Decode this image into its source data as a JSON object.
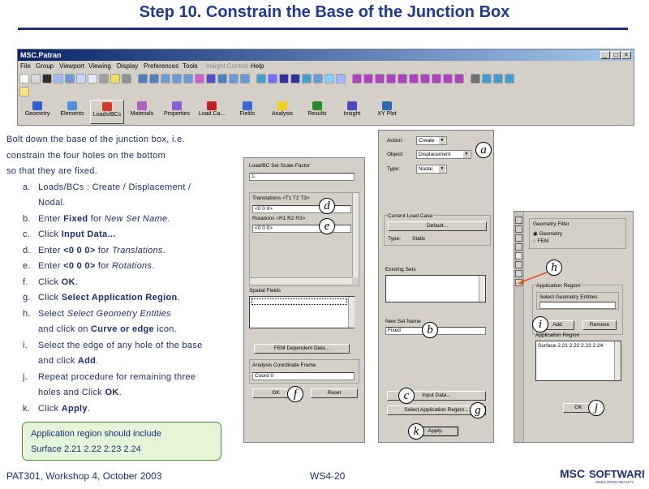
{
  "slide": {
    "title": "Step 10.  Constrain the Base of the Junction Box",
    "footer_left": "PAT301, Workshop 4, October 2003",
    "footer_center": "WS4-20",
    "logo": "MSC SOFTWARE",
    "logo_sub": "SIMULATING REALITY"
  },
  "app": {
    "window_title": "MSC.Patran",
    "menus": [
      "File",
      "Group",
      "Viewport",
      "Viewing",
      "Display",
      "Preferences",
      "Tools",
      "Insight Control",
      "Help"
    ],
    "app_tabs": [
      "Geometry",
      "Elements",
      "Loads/BCs",
      "Materials",
      "Properties",
      "Load Ca...",
      "Fields",
      "Analysis",
      "Results",
      "Insight",
      "XY Plot"
    ],
    "selected_tab": "Loads/BCs"
  },
  "instructions": {
    "intro": [
      "Bolt down the base of the junction box, i.e.",
      "constrain the four holes on the bottom",
      "so that they are fixed."
    ],
    "steps": [
      {
        "mark": "a.",
        "parts": [
          {
            "t": "Loads/BCs : Create / Displacement /"
          }
        ]
      },
      {
        "mark": "",
        "parts": [
          {
            "t": "Nodal."
          }
        ]
      },
      {
        "mark": "b.",
        "parts": [
          {
            "t": "Enter "
          },
          {
            "t": "Fixed",
            "b": true
          },
          {
            "t": " for "
          },
          {
            "t": "New Set Name",
            "i": true
          },
          {
            "t": "."
          }
        ]
      },
      {
        "mark": "c.",
        "parts": [
          {
            "t": "Click "
          },
          {
            "t": "Input Data...",
            "b": true
          }
        ]
      },
      {
        "mark": "d.",
        "parts": [
          {
            "t": "Enter "
          },
          {
            "t": "<0 0 0>",
            "b": true
          },
          {
            "t": " for "
          },
          {
            "t": "Translations",
            "i": true
          },
          {
            "t": "."
          }
        ]
      },
      {
        "mark": "e.",
        "parts": [
          {
            "t": "Enter "
          },
          {
            "t": "<0 0 0>",
            "b": true
          },
          {
            "t": " for "
          },
          {
            "t": "Rotations",
            "i": true
          },
          {
            "t": "."
          }
        ]
      },
      {
        "mark": "f.",
        "parts": [
          {
            "t": "Click "
          },
          {
            "t": "OK",
            "b": true
          },
          {
            "t": "."
          }
        ]
      },
      {
        "mark": "g.",
        "parts": [
          {
            "t": "Click "
          },
          {
            "t": "Select Application Region",
            "b": true
          },
          {
            "t": "."
          }
        ]
      },
      {
        "mark": "h.",
        "parts": [
          {
            "t": "Select "
          },
          {
            "t": "Select Geometry Entities",
            "i": true
          }
        ]
      },
      {
        "mark": "",
        "parts": [
          {
            "t": "and click on "
          },
          {
            "t": "Curve or edge",
            "b": true
          },
          {
            "t": " icon."
          }
        ]
      },
      {
        "mark": "i.",
        "parts": [
          {
            "t": "Select the edge of any hole of the base"
          }
        ]
      },
      {
        "mark": "",
        "parts": [
          {
            "t": "and click "
          },
          {
            "t": "Add",
            "b": true
          },
          {
            "t": "."
          }
        ]
      },
      {
        "mark": "j.",
        "parts": [
          {
            "t": "Repeat procedure for remaining three"
          }
        ]
      },
      {
        "mark": "",
        "parts": [
          {
            "t": "holes and Click "
          },
          {
            "t": "OK",
            "b": true
          },
          {
            "t": "."
          }
        ]
      },
      {
        "mark": "k.",
        "parts": [
          {
            "t": "Click "
          },
          {
            "t": "Apply",
            "b": true
          },
          {
            "t": "."
          }
        ]
      }
    ],
    "note": [
      "Application region should include",
      "Surface 2.21 2.22 2.23 2.24"
    ]
  },
  "input_panel": {
    "scale_label": "Load/BC Set Scale Factor",
    "scale_value": "1.",
    "translations_label": "Translations <T1 T2 T3>",
    "translations_value": "<0 0 0>",
    "rotations_label": "Rotations <R1 R2 R3>",
    "rotations_value": "<0 0 0>",
    "spatial_label": "Spatial Fields",
    "fem_button": "FEM Dependent Data...",
    "frame_label": "Analysis Coordinate Frame",
    "frame_value": "Coord 0",
    "ok": "OK",
    "reset": "Reset"
  },
  "loads_panel": {
    "action_label": "Action:",
    "action_value": "Create",
    "object_label": "Object:",
    "object_value": "Displacement",
    "type_label": "Type:",
    "type_value": "Nodal",
    "current_case_label": "Current Load Case:",
    "current_case_value": "Default...",
    "type2_label": "Type:",
    "type2_value": "Static",
    "existing_label": "Existing Sets",
    "new_set_label": "New Set Name",
    "new_set_value": "Fixed",
    "input_data": "Input Data...",
    "select_region": "Select Application Region...",
    "apply": "-Apply-"
  },
  "region_panel": {
    "filter_label": "Geometry Filter",
    "opt_geometry": "Geometry",
    "opt_fem": "FEM",
    "app_region_label": "Application Region",
    "select_label": "Select Geometry Entities",
    "add": "Add",
    "remove": "Remove",
    "region_list_label": "Application Region",
    "region_value": "Surface 2.21 2.22 2.23 2.24",
    "ok": "OK"
  },
  "callouts": {
    "a": "a",
    "b": "b",
    "c": "c",
    "d": "d",
    "e": "e",
    "f": "f",
    "g": "g",
    "h": "h",
    "i": "i",
    "j": "j",
    "k": "k"
  },
  "colors": {
    "title": "#1c3a9a",
    "accent": "#e0521e",
    "note_bg": "#e5f6d8",
    "panel": "#d4d0c8"
  }
}
